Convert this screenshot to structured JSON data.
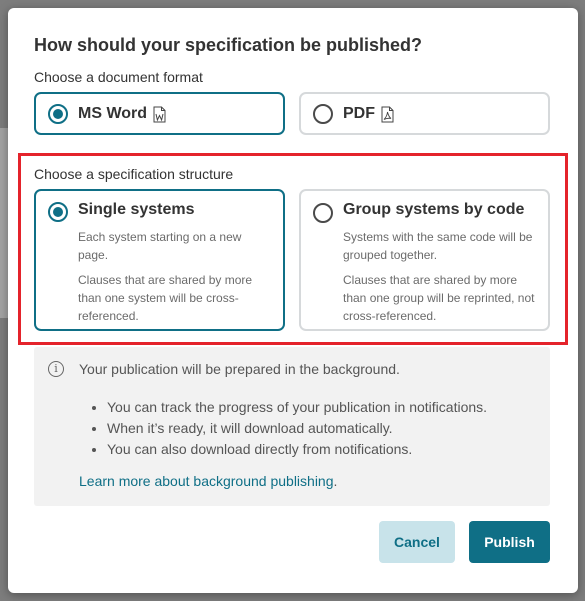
{
  "dialog": {
    "title": "How should your specification be published?"
  },
  "format": {
    "label": "Choose a document format",
    "options": [
      {
        "label": "MS Word",
        "icon": "word-document-icon",
        "selected": true
      },
      {
        "label": "PDF",
        "icon": "pdf-document-icon",
        "selected": false
      }
    ]
  },
  "structure": {
    "label": "Choose a specification structure",
    "options": [
      {
        "label": "Single systems",
        "selected": true,
        "desc1": "Each system starting on a new page.",
        "desc2": "Clauses that are shared by more than one system will be cross-referenced."
      },
      {
        "label": "Group systems by code",
        "selected": false,
        "desc1": "Systems with the same code will be grouped together.",
        "desc2": "Clauses that are shared by more than one group will be reprinted, not cross-referenced."
      }
    ]
  },
  "info": {
    "icon": "info-icon",
    "text": "Your publication will be prepared in the background.",
    "bullets": [
      "You can track the progress of your publication in notifications.",
      "When it’s ready, it will download automatically.",
      "You can also download directly from notifications."
    ],
    "link": "Learn more about background publishing",
    "link_suffix": "."
  },
  "buttons": {
    "cancel": "Cancel",
    "publish": "Publish"
  },
  "colors": {
    "accent": "#0f6f86",
    "highlight": "#e4232b"
  }
}
